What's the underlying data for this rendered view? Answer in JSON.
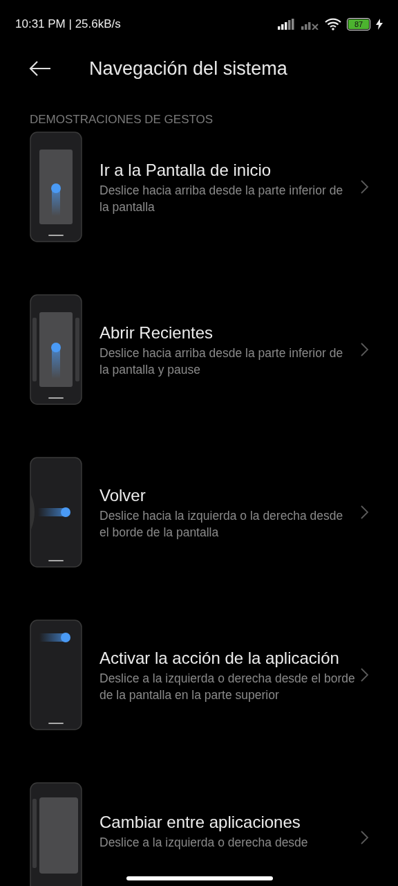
{
  "status_bar": {
    "time": "10:31 PM | 25.6kB/s",
    "battery": "87"
  },
  "header": {
    "title": "Navegación del sistema"
  },
  "section": {
    "label": "DEMOSTRACIONES DE GESTOS"
  },
  "items": [
    {
      "kind": "home",
      "title": "Ir a la Pantalla de inicio",
      "subtitle": "Deslice hacia arriba desde la parte inferior de la pantalla"
    },
    {
      "kind": "recents",
      "title": "Abrir Recientes",
      "subtitle": "Deslice hacia arriba desde la parte inferior de la pantalla y pause"
    },
    {
      "kind": "back",
      "title": "Volver",
      "subtitle": "Deslice hacia la izquierda o la derecha desde el borde de la pantalla"
    },
    {
      "kind": "app-action",
      "title": "Activar la acción de la aplicación",
      "subtitle": "Deslice a la izquierda o derecha desde el borde de la pantalla en la parte superior"
    },
    {
      "kind": "switch",
      "title": "Cambiar entre aplicaciones",
      "subtitle": "Deslice a la izquierda o derecha desde"
    }
  ]
}
